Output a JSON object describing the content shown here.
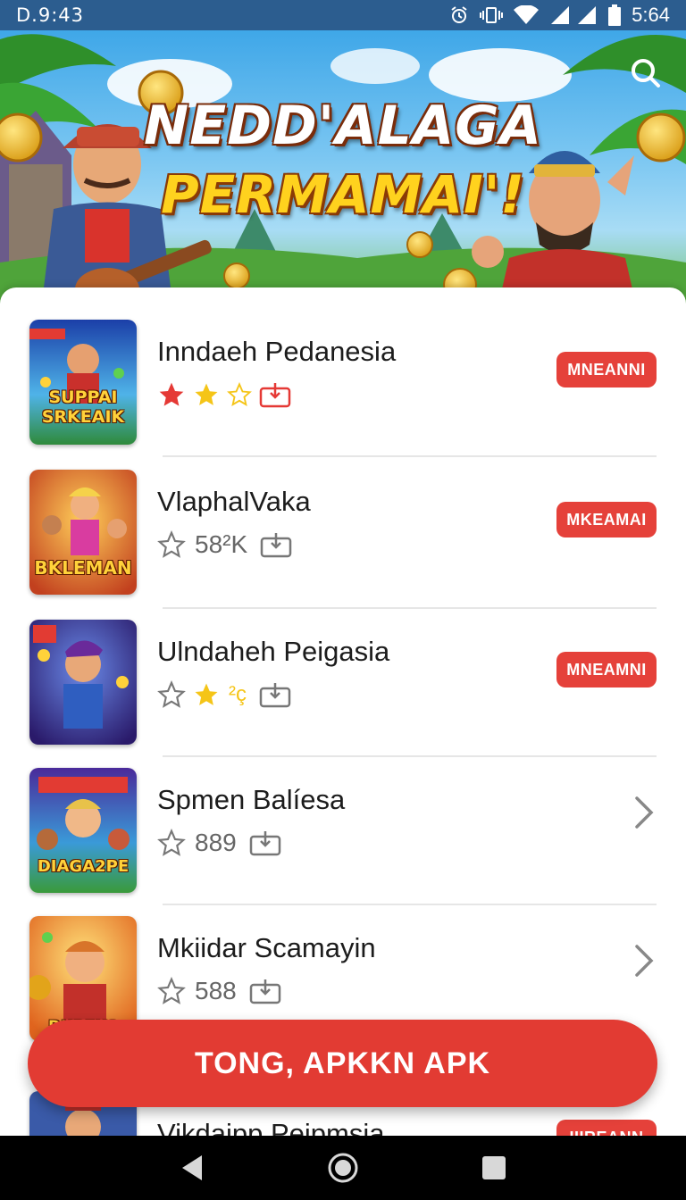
{
  "status_bar": {
    "left_text": "D.9:43",
    "time": "5:64",
    "icons": [
      "alarm-icon",
      "vibrate-icon",
      "wifi-icon",
      "signal-icon",
      "battery-icon"
    ]
  },
  "hero": {
    "title_line1": "NEDD'ALAGA",
    "title_line2": "PERMAMAI'!",
    "search_icon": "search-icon"
  },
  "apps": [
    {
      "title": "Inndaeh Pedanesia",
      "thumb_text": "SUPPAI SRKEAIK",
      "rating_display": "stars",
      "count": "",
      "action": "MNEANNI",
      "action_type": "button"
    },
    {
      "title": "VlaphalVaka",
      "thumb_text": "BKLEMAN",
      "rating_display": "outline",
      "count": "58²K",
      "action": "MKEAMAI",
      "action_type": "button"
    },
    {
      "title": "Ulndaheh Peigasia",
      "thumb_text": "",
      "rating_display": "mixed",
      "count": "²ç",
      "action": "MNEAMNI",
      "action_type": "button"
    },
    {
      "title": "Spmen Balíesa",
      "thumb_text": "DIAGA2PE",
      "rating_display": "outline",
      "count": "889",
      "action": "",
      "action_type": "chevron"
    },
    {
      "title": "Mkiidar Scamayin",
      "thumb_text": "DUBEKS",
      "rating_display": "outline",
      "count": "588",
      "action": "",
      "action_type": "chevron"
    },
    {
      "title": "Vikdaipp Peipmsia",
      "thumb_text": "",
      "rating_display": "outline",
      "count": "",
      "action": "IIIREANN",
      "action_type": "button"
    }
  ],
  "cta": {
    "label": "TONG, APKKN APK"
  },
  "nav_bar": {
    "icons": [
      "back-icon",
      "home-icon",
      "recents-icon"
    ]
  },
  "colors": {
    "accent": "#e5413a",
    "status_bar": "#2c5d8f",
    "star_red": "#e53935",
    "star_yellow": "#f5c518"
  }
}
